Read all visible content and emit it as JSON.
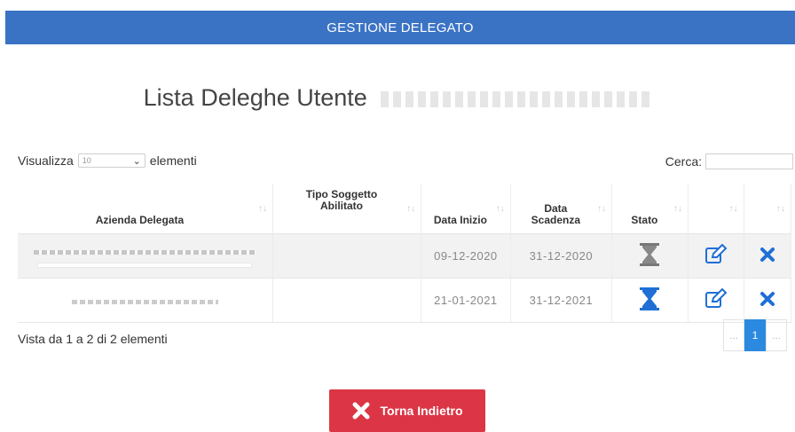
{
  "header": {
    "title": "GESTIONE DELEGATO"
  },
  "page": {
    "title": "Lista Deleghe Utente"
  },
  "length_menu": {
    "prefix": "Visualizza",
    "selected": "10",
    "suffix": "elementi"
  },
  "search": {
    "label": "Cerca:",
    "value": ""
  },
  "table": {
    "columns": [
      "Azienda Delegata",
      "Tipo Soggetto Abilitato",
      "Data Inizio",
      "Data Scadenza",
      "Stato",
      "",
      ""
    ],
    "rows": [
      {
        "azienda": "",
        "tipo": "",
        "data_inizio": "09-12-2020",
        "data_scadenza": "31-12-2020",
        "stato": "expired-hourglass-icon"
      },
      {
        "azienda": "",
        "tipo": "",
        "data_inizio": "21-01-2021",
        "data_scadenza": "31-12-2021",
        "stato": "active-hourglass-icon"
      }
    ]
  },
  "info": {
    "text": "Vista da 1 a 2 di 2 elementi"
  },
  "pagination": {
    "prev": "...",
    "current": "1",
    "next": "..."
  },
  "back_button": {
    "label": "Torna Indietro",
    "icon": "close-icon"
  },
  "colors": {
    "header": "#3b73c4",
    "expired": "#777777",
    "active": "#1f6fd6",
    "danger": "#dc3545",
    "page_active": "#2b8ae0"
  }
}
